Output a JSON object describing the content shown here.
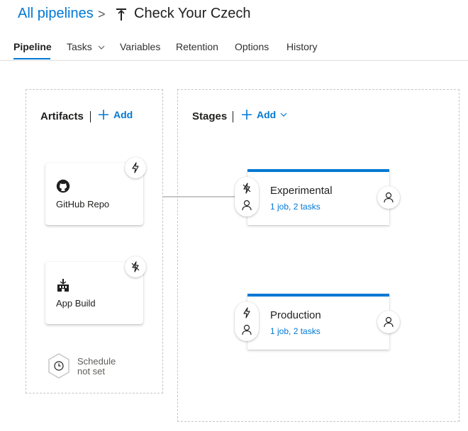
{
  "breadcrumb": {
    "all_pipelines": "All pipelines",
    "separator": ">",
    "pipeline_name": "Check Your Czech"
  },
  "tabs": [
    {
      "label": "Pipeline",
      "active": true
    },
    {
      "label": "Tasks",
      "has_dropdown": true
    },
    {
      "label": "Variables"
    },
    {
      "label": "Retention"
    },
    {
      "label": "Options"
    },
    {
      "label": "History"
    }
  ],
  "artifacts": {
    "title": "Artifacts",
    "add_label": "Add",
    "items": [
      {
        "label": "GitHub Repo",
        "icon": "github-icon",
        "trigger_icon": "lightning-icon"
      },
      {
        "label": "App Build",
        "icon": "build-icon",
        "trigger_icon": "lightning-off-icon"
      }
    ],
    "schedule": {
      "line1": "Schedule",
      "line2": "not set",
      "icon": "clock-icon"
    }
  },
  "stages": {
    "title": "Stages",
    "add_label": "Add",
    "items": [
      {
        "name": "Experimental",
        "summary": "1 job, 2 tasks"
      },
      {
        "name": "Production",
        "summary": "1 job, 2 tasks"
      }
    ]
  },
  "colors": {
    "accent": "#0078d4",
    "text": "#201f1e",
    "border": "#c8c6c4"
  }
}
